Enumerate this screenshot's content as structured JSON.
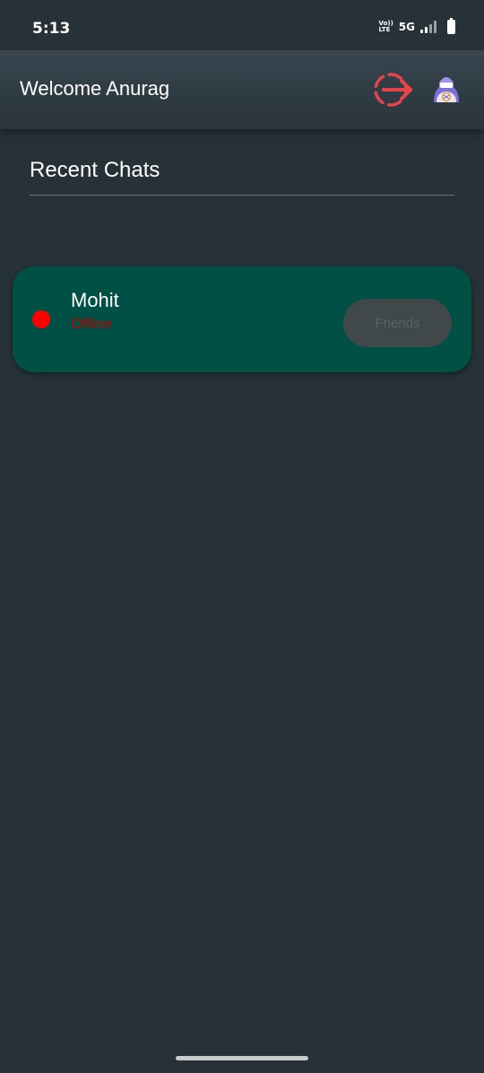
{
  "status_bar": {
    "time": "5:13",
    "volte_top": "Vo))",
    "volte_bottom": "LTE",
    "network": "5G",
    "signal_icon": "signal-bars-icon",
    "battery_icon": "battery-icon"
  },
  "app_bar": {
    "title": "Welcome Anurag",
    "logout_icon": "logout-icon",
    "avatar_icon": "avatar-icon"
  },
  "recent_chats": {
    "title": "Recent Chats",
    "items": [
      {
        "name": "Mohit",
        "status": "Offline",
        "status_color": "#ff0000",
        "action_label": "Friends"
      }
    ]
  },
  "colors": {
    "background": "#263238",
    "card": "#005045",
    "accent_red": "#e8434b",
    "offline_text": "#c00000"
  }
}
